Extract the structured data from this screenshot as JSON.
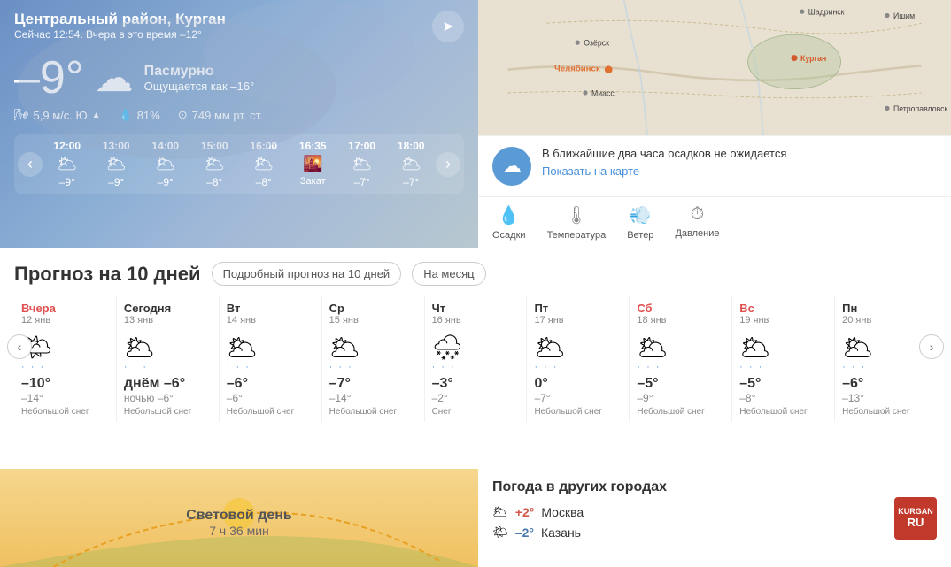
{
  "location": {
    "city": "Центральный район, Курган",
    "time": "Сейчас 12:54. Вчера в это время",
    "yesterday_temp": "–12°"
  },
  "current": {
    "temp": "–9°",
    "condition": "Пасмурно",
    "feels_like_label": "Ощущается как",
    "feels_like": "–16°",
    "wind": "5,9 м/с. Ю",
    "humidity": "81%",
    "pressure": "749 мм рт. ст."
  },
  "hourly": [
    {
      "time": "12:00",
      "icon": "🌥",
      "temp": "–9°",
      "special": ""
    },
    {
      "time": "13:00",
      "icon": "🌥",
      "temp": "–9°",
      "special": ""
    },
    {
      "time": "14:00",
      "icon": "🌥",
      "temp": "–9°",
      "special": ""
    },
    {
      "time": "15:00",
      "icon": "🌥",
      "temp": "–8°",
      "special": ""
    },
    {
      "time": "16:00",
      "icon": "🌥",
      "temp": "–8°",
      "special": ""
    },
    {
      "time": "16:35",
      "icon": "🌇",
      "temp": "Закат",
      "special": "sunset"
    },
    {
      "time": "17:00",
      "icon": "🌥",
      "temp": "–7°",
      "special": ""
    },
    {
      "time": "18:00",
      "icon": "🌥",
      "temp": "–7°",
      "special": ""
    }
  ],
  "map": {
    "cities": [
      "Шадринск",
      "Ишим",
      "Озёрск",
      "Курган",
      "Челябинск",
      "Миасс",
      "Петропавловск"
    ]
  },
  "no_precip": {
    "text": "В ближайшие два часа осадков не ожидается",
    "map_link": "Показать на карте"
  },
  "metrics": [
    {
      "icon": "💧",
      "label": "Осадки"
    },
    {
      "icon": "🌡",
      "label": "Температура"
    },
    {
      "icon": "💨",
      "label": "Ветер"
    },
    {
      "icon": "⏱",
      "label": "Давление"
    }
  ],
  "forecast": {
    "title": "Прогноз на 10 дней",
    "btn1": "Подробный прогноз на 10 дней",
    "btn2": "На месяц",
    "days": [
      {
        "name": "Вчера",
        "weekend": false,
        "yesterday": true,
        "date": "12 янв",
        "high": "–10°",
        "low": "–14°",
        "desc": "Небольшой снег",
        "icon": "🌤",
        "snow": true
      },
      {
        "name": "Сегодня",
        "weekend": false,
        "yesterday": false,
        "date": "13 янв",
        "high": "днём –6°",
        "low": "ночью –6°",
        "desc": "Небольшой снег",
        "icon": "🌥",
        "snow": true
      },
      {
        "name": "Вт",
        "weekend": false,
        "yesterday": false,
        "date": "14 янв",
        "high": "–6°",
        "low": "–6°",
        "desc": "Небольшой снег",
        "icon": "🌥",
        "snow": true
      },
      {
        "name": "Ср",
        "weekend": false,
        "yesterday": false,
        "date": "15 янв",
        "high": "–7°",
        "low": "–14°",
        "desc": "Небольшой снег",
        "icon": "🌥",
        "snow": true
      },
      {
        "name": "Чт",
        "weekend": false,
        "yesterday": false,
        "date": "16 янв",
        "high": "–3°",
        "low": "–2°",
        "desc": "Снег",
        "icon": "🌨",
        "snow": true
      },
      {
        "name": "Пт",
        "weekend": false,
        "yesterday": false,
        "date": "17 янв",
        "high": "0°",
        "low": "–7°",
        "desc": "Небольшой снег",
        "icon": "🌥",
        "snow": true
      },
      {
        "name": "Сб",
        "weekend": true,
        "yesterday": false,
        "date": "18 янв",
        "high": "–5°",
        "low": "–9°",
        "desc": "Небольшой снег",
        "icon": "🌥",
        "snow": true
      },
      {
        "name": "Вс",
        "weekend": true,
        "yesterday": false,
        "date": "19 янв",
        "high": "–5°",
        "low": "–8°",
        "desc": "Небольшой снег",
        "icon": "🌥",
        "snow": true
      },
      {
        "name": "Пн",
        "weekend": false,
        "yesterday": false,
        "date": "20 янв",
        "high": "–6°",
        "low": "–13°",
        "desc": "Небольшой снег",
        "icon": "🌥",
        "snow": true
      }
    ]
  },
  "solar": {
    "title": "Световой день",
    "duration": "7 ч 36 мин"
  },
  "other_cities": {
    "title": "Погода в других городах",
    "cities": [
      {
        "temp": "+2°",
        "positive": true,
        "name": "Москва",
        "icon": "🌥"
      },
      {
        "temp": "–2°",
        "positive": false,
        "name": "Казань",
        "icon": "🌤"
      }
    ]
  },
  "logo": {
    "line1": "KURGAN",
    "line2": "RU"
  }
}
